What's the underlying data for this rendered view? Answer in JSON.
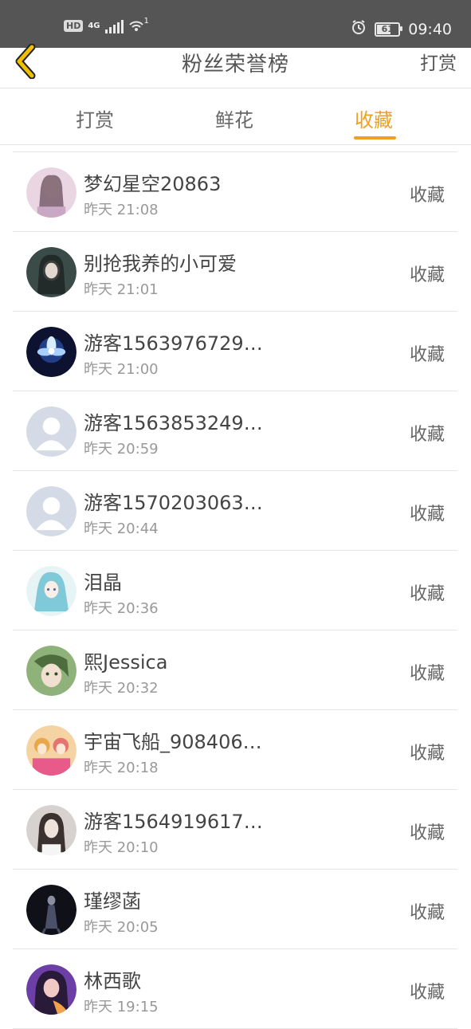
{
  "status_bar": {
    "hd": "HD",
    "network": "4G",
    "wifi_badge": "1",
    "battery": "61",
    "time": "09:40"
  },
  "header": {
    "title": "粉丝荣誉榜",
    "right_link": "打赏",
    "back_icon": "chevron-left-icon",
    "back_color": "#f0c000"
  },
  "tabs": [
    {
      "label": "打赏",
      "active": false
    },
    {
      "label": "鲜花",
      "active": false
    },
    {
      "label": "收藏",
      "active": true
    }
  ],
  "accent_color": "#f0a020",
  "entries": [
    {
      "name": "梦幻星空20863",
      "time": "昨天 21:08",
      "action": "收藏",
      "avatar": "photo-girl-pink"
    },
    {
      "name": "别抢我养的小可爱",
      "time": "昨天 21:01",
      "action": "收藏",
      "avatar": "photo-girl-dark"
    },
    {
      "name": "游客1563976729…",
      "time": "昨天 21:00",
      "action": "收藏",
      "avatar": "photo-glowing-flower"
    },
    {
      "name": "游客1563853249…",
      "time": "昨天 20:59",
      "action": "收藏",
      "avatar": "default-avatar"
    },
    {
      "name": "游客1570203063…",
      "time": "昨天 20:44",
      "action": "收藏",
      "avatar": "default-avatar"
    },
    {
      "name": "泪晶",
      "time": "昨天 20:36",
      "action": "收藏",
      "avatar": "anime-blue-girl"
    },
    {
      "name": "熙Jessica",
      "time": "昨天 20:32",
      "action": "收藏",
      "avatar": "anime-green-portrait"
    },
    {
      "name": "宇宙飞船_908406…",
      "time": "昨天 20:18",
      "action": "收藏",
      "avatar": "anime-colorful-girls"
    },
    {
      "name": "游客1564919617…",
      "time": "昨天 20:10",
      "action": "收藏",
      "avatar": "photo-girl-light"
    },
    {
      "name": "瑾缪菡",
      "time": "昨天 20:05",
      "action": "收藏",
      "avatar": "photo-dark-figure"
    },
    {
      "name": "林西歌",
      "time": "昨天 19:15",
      "action": "收藏",
      "avatar": "photo-girl-purple"
    }
  ]
}
